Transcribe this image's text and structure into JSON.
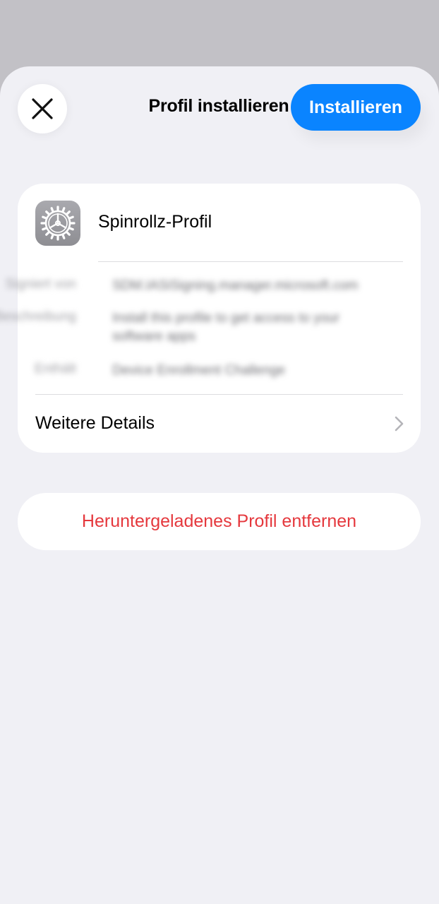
{
  "header": {
    "title": "Profil installieren",
    "install_label": "Installieren",
    "close_icon": "close-icon"
  },
  "profile": {
    "name": "Spinrollz-Profil",
    "icon": "settings-gear-icon",
    "rows": [
      {
        "key": "Signiert von",
        "value": "SDM.IASiSigning.manager.microsoft.com"
      },
      {
        "key": "Beschreibung",
        "value": "Install this profile to get access to your software apps"
      },
      {
        "key": "Enthält",
        "value": "Device Enrollment Challenge"
      }
    ],
    "more_details": "Weitere Details"
  },
  "actions": {
    "remove_label": "Heruntergeladenes Profil entfernen"
  },
  "colors": {
    "accent": "#0a84ff",
    "destructive": "#e5383d",
    "sheet_bg": "#f0f0f5",
    "dim_bg": "#c2c1c6"
  }
}
